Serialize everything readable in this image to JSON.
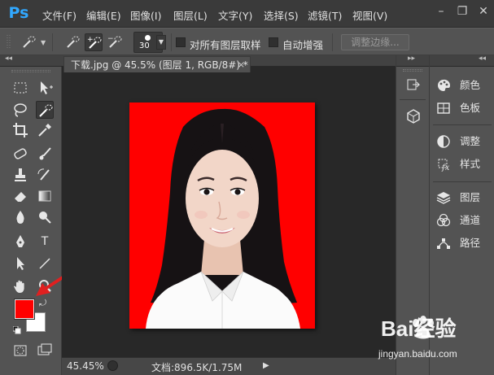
{
  "app": {
    "logo": "Ps"
  },
  "menu": [
    "文件(F)",
    "编辑(E)",
    "图像(I)",
    "图层(L)",
    "文字(Y)",
    "选择(S)",
    "滤镜(T)",
    "视图(V)"
  ],
  "window_controls": {
    "minimize": "–",
    "restore": "❐",
    "close": "✕"
  },
  "options": {
    "brush_size": "30",
    "sample_all_layers": "对所有图层取样",
    "auto_enhance": "自动增强",
    "refine_edge": "调整边缘..."
  },
  "document": {
    "tab_title": "下载.jpg @ 45.5% (图层 1, RGB/8#) *",
    "close": "×"
  },
  "status": {
    "zoom": "45.45%",
    "doc_info": "文档:896.5K/1.75M"
  },
  "colors": {
    "foreground": "#ff0000",
    "background": "#ffffff",
    "photo_background": "#ff0000",
    "logo": "#31a8ff"
  },
  "panels": [
    {
      "label": "颜色",
      "icon": "palette-icon"
    },
    {
      "label": "色板",
      "icon": "swatches-icon"
    },
    {
      "label": "调整",
      "icon": "adjustments-icon"
    },
    {
      "label": "样式",
      "icon": "styles-icon"
    },
    {
      "label": "图层",
      "icon": "layers-icon"
    },
    {
      "label": "通道",
      "icon": "channels-icon"
    },
    {
      "label": "路径",
      "icon": "paths-icon"
    }
  ],
  "watermark": {
    "brand": "Bai经验",
    "url": "jingyan.baidu.com"
  }
}
